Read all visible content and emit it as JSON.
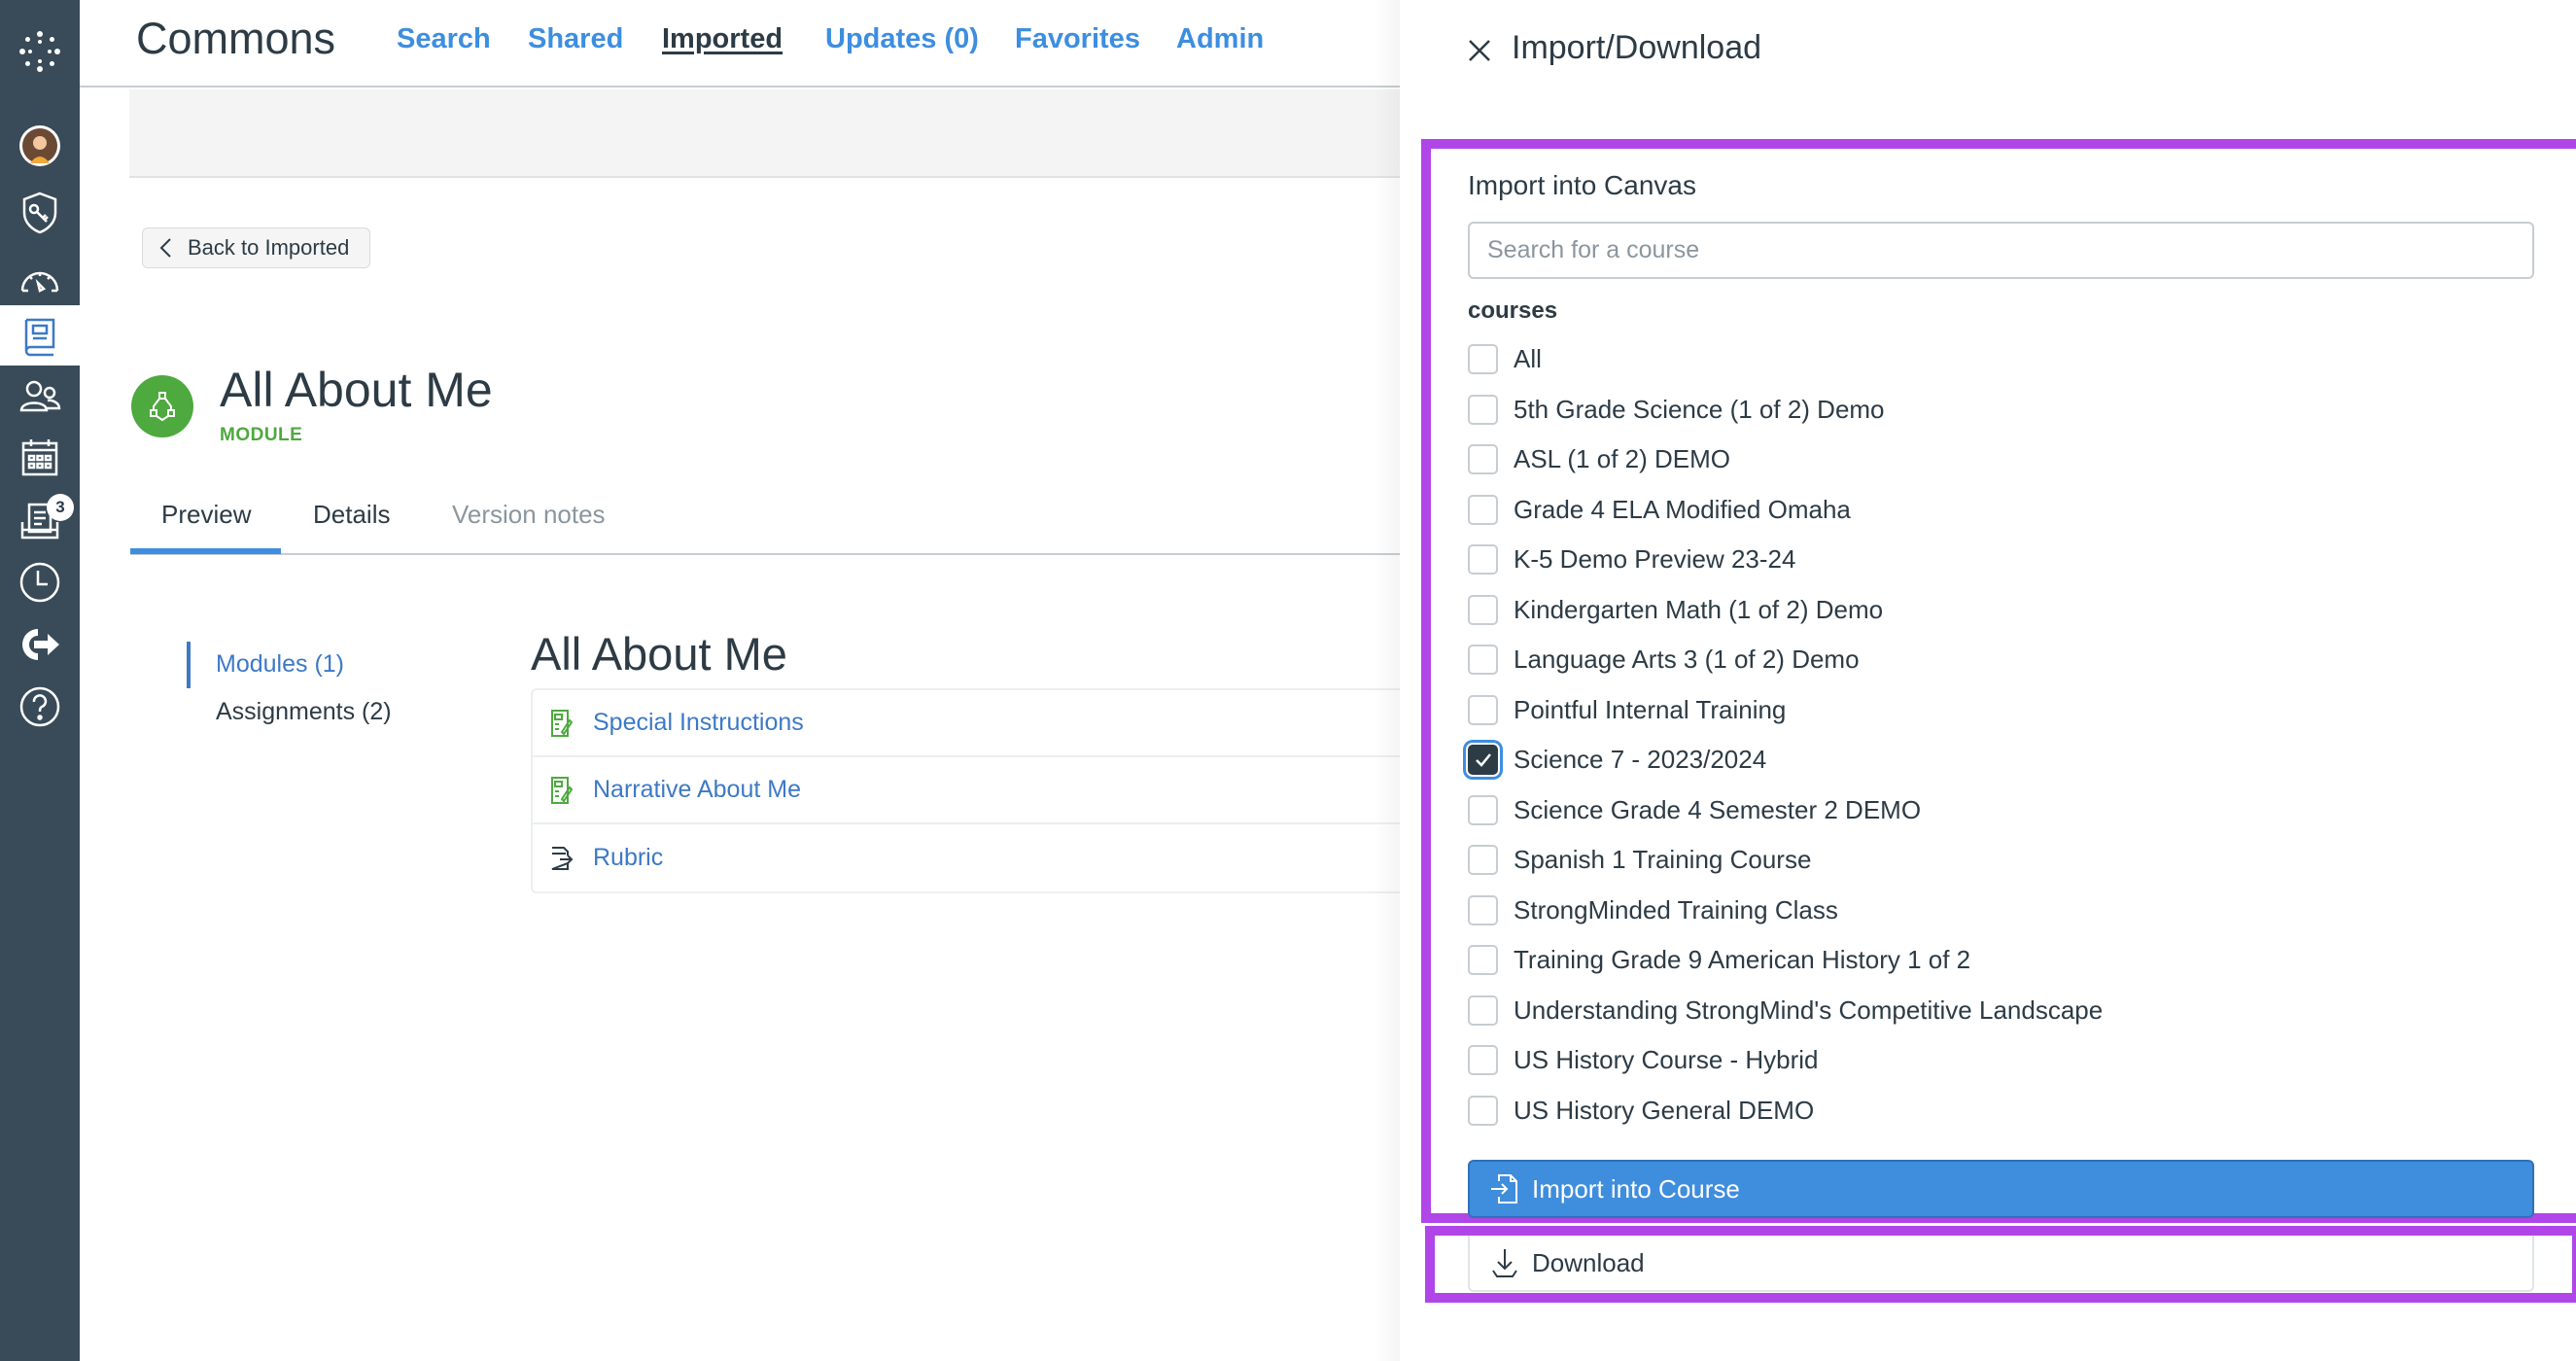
{
  "global_nav": {
    "items": [
      {
        "name": "canvas-logo",
        "label": "Canvas"
      },
      {
        "name": "account",
        "label": "Account"
      },
      {
        "name": "admin",
        "label": "Admin"
      },
      {
        "name": "dashboard",
        "label": "Dashboard"
      },
      {
        "name": "commons",
        "label": "Commons",
        "active": true
      },
      {
        "name": "groups",
        "label": "Groups"
      },
      {
        "name": "calendar",
        "label": "Calendar"
      },
      {
        "name": "inbox",
        "label": "Inbox",
        "badge": "3"
      },
      {
        "name": "history",
        "label": "History"
      },
      {
        "name": "logout",
        "label": "Logout"
      },
      {
        "name": "help",
        "label": "Help"
      }
    ],
    "inbox_badge": "3",
    "bg_color": "#394b58"
  },
  "header": {
    "title": "Commons",
    "nav": [
      {
        "label": "Search"
      },
      {
        "label": "Shared"
      },
      {
        "label": "Imported",
        "current": true
      },
      {
        "label": "Updates (0)"
      },
      {
        "label": "Favorites"
      },
      {
        "label": "Admin"
      }
    ]
  },
  "back_button": {
    "label": "Back to Imported"
  },
  "resource": {
    "title": "All About Me",
    "type": "MODULE",
    "type_color": "#4ea93f"
  },
  "tabs": [
    {
      "label": "Preview",
      "selected": true
    },
    {
      "label": "Details"
    },
    {
      "label": "Version notes",
      "disabled": true
    }
  ],
  "side_nav": [
    {
      "label": "Modules (1)",
      "active": true
    },
    {
      "label": "Assignments (2)"
    }
  ],
  "module": {
    "heading": "All About Me",
    "items": [
      {
        "label": "Special Instructions",
        "icon": "assignment-icon"
      },
      {
        "label": "Narrative About Me",
        "icon": "assignment-icon"
      },
      {
        "label": "Rubric",
        "icon": "external-tool-icon"
      }
    ]
  },
  "drawer": {
    "title": "Import/Download",
    "close_label": "Close",
    "section_title": "Import into Canvas",
    "search_placeholder": "Search for a course",
    "search_value": "",
    "courses_label": "courses",
    "courses": [
      {
        "label": "All",
        "checked": false
      },
      {
        "label": "5th Grade Science (1 of 2) Demo",
        "checked": false
      },
      {
        "label": "ASL (1 of 2) DEMO",
        "checked": false
      },
      {
        "label": "Grade 4 ELA Modified Omaha",
        "checked": false
      },
      {
        "label": "K-5 Demo Preview 23-24",
        "checked": false
      },
      {
        "label": "Kindergarten Math (1 of 2) Demo",
        "checked": false
      },
      {
        "label": "Language Arts 3 (1 of 2) Demo",
        "checked": false
      },
      {
        "label": "Pointful Internal Training",
        "checked": false
      },
      {
        "label": "Science 7 - 2023/2024",
        "checked": true
      },
      {
        "label": "Science Grade 4 Semester 2 DEMO",
        "checked": false
      },
      {
        "label": "Spanish 1 Training Course",
        "checked": false
      },
      {
        "label": "StrongMinded Training Class",
        "checked": false
      },
      {
        "label": "Training Grade 9 American History 1 of 2",
        "checked": false
      },
      {
        "label": "Understanding StrongMind's Competitive Landscape",
        "checked": false
      },
      {
        "label": "US History Course - Hybrid",
        "checked": false
      },
      {
        "label": "US History General DEMO",
        "checked": false
      }
    ],
    "import_button": "Import into Course",
    "download_button": "Download",
    "highlight_color": "#b046e8",
    "primary_color": "#3f8ddd"
  }
}
